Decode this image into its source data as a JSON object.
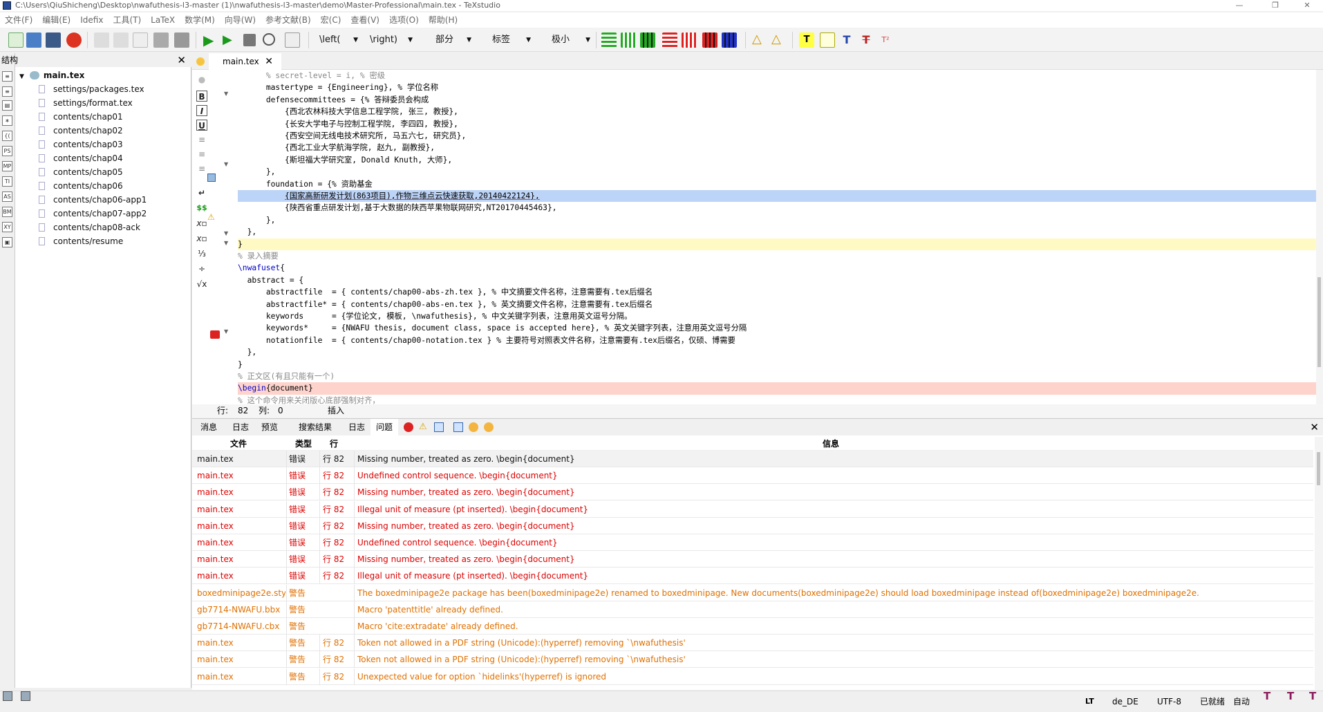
{
  "window": {
    "title": "C:\\Users\\QiuShicheng\\Desktop\\nwafuthesis-l3-master (1)\\nwafuthesis-l3-master\\demo\\Master-Professional\\main.tex - TeXstudio"
  },
  "menu": [
    "文件(F)",
    "编辑(E)",
    "Idefix",
    "工具(T)",
    "LaTeX",
    "数学(M)",
    "向导(W)",
    "参考文献(B)",
    "宏(C)",
    "查看(V)",
    "选项(O)",
    "帮助(H)"
  ],
  "toolbar": {
    "left_dd": "\\left(",
    "right_dd": "\\right)",
    "section_dd": "部分",
    "label_dd": "标签",
    "size_dd": "极小"
  },
  "structure": {
    "title": "结构",
    "root": "main.tex",
    "files": [
      "settings/packages.tex",
      "settings/format.tex",
      "contents/chap01",
      "contents/chap02",
      "contents/chap03",
      "contents/chap04",
      "contents/chap05",
      "contents/chap06",
      "contents/chap06-app1",
      "contents/chap07-app2",
      "contents/chap08-ack",
      "contents/resume"
    ]
  },
  "editor": {
    "tab": "main.tex",
    "lines": [
      {
        "pre": "      ",
        "kw": "",
        "text": "% secret-level = i, % 密级",
        "cls": "cmt"
      },
      {
        "pre": "      ",
        "kw": "",
        "text": "mastertype = {Engineering}, % 学位名称",
        "cls": ""
      },
      {
        "pre": "      ",
        "kw": "",
        "text": "defensecommittees = {% 答辩委员会构成",
        "cls": ""
      },
      {
        "pre": "          ",
        "kw": "",
        "text": "{西北农林科技大学信息工程学院, 张三, 教授},",
        "cls": ""
      },
      {
        "pre": "          ",
        "kw": "",
        "text": "{长安大学电子与控制工程学院, 李四四, 教授},",
        "cls": ""
      },
      {
        "pre": "          ",
        "kw": "",
        "text": "{西安空间无线电技术研究所, 马五六七, 研究员},",
        "cls": ""
      },
      {
        "pre": "          ",
        "kw": "",
        "text": "{西北工业大学航海学院, 赵九, 副教授},",
        "cls": ""
      },
      {
        "pre": "          ",
        "kw": "",
        "text": "{斯坦福大学研究室, Donald Knuth, 大师},",
        "cls": ""
      },
      {
        "pre": "      ",
        "kw": "",
        "text": "},",
        "cls": ""
      },
      {
        "pre": "      ",
        "kw": "",
        "text": "foundation = {% 资助基金",
        "cls": ""
      },
      {
        "pre": "          ",
        "kw": "",
        "text": "{国家高新研发计划(863项目),作物三维点云快速获取,20140422124},",
        "cls": "hl-sel"
      },
      {
        "pre": "          ",
        "kw": "",
        "text": "{陕西省重点研发计划,基于大数据的陕西苹果物联网研究,NT20170445463},",
        "cls": ""
      },
      {
        "pre": "      ",
        "kw": "",
        "text": "},",
        "cls": ""
      },
      {
        "pre": "  ",
        "kw": "",
        "text": "},",
        "cls": ""
      },
      {
        "pre": "",
        "kw": "",
        "text": "}",
        "cls": "hl-y"
      },
      {
        "pre": "",
        "kw": "",
        "text": "% 录入摘要",
        "cls": "cmt"
      },
      {
        "pre": "",
        "kw": "\\nwafuset",
        "text": "{",
        "cls": ""
      },
      {
        "pre": "  ",
        "kw": "",
        "text": "abstract = {",
        "cls": ""
      },
      {
        "pre": "      ",
        "kw": "",
        "text": "abstractfile  = { contents/chap00-abs-zh.tex }, % 中文摘要文件名称，注意需要有.tex后缀名",
        "cls": ""
      },
      {
        "pre": "      ",
        "kw": "",
        "text": "abstractfile* = { contents/chap00-abs-en.tex }, % 英文摘要文件名称，注意需要有.tex后缀名",
        "cls": ""
      },
      {
        "pre": "      ",
        "kw": "",
        "text": "keywords      = {学位论文, 模板, \\nwafuthesis}, % 中文关键字列表，注意用英文逗号分隔。",
        "cls": ""
      },
      {
        "pre": "      ",
        "kw": "",
        "text": "keywords*     = {NWAFU thesis, document class, space is accepted here}, % 英文关键字列表，注意用英文逗号分隔",
        "cls": ""
      },
      {
        "pre": "      ",
        "kw": "",
        "text": "notationfile  = { contents/chap00-notation.tex } % 主要符号对照表文件名称，注意需要有.tex后缀名，仅硕、博需要",
        "cls": ""
      },
      {
        "pre": "  ",
        "kw": "",
        "text": "},",
        "cls": ""
      },
      {
        "pre": "",
        "kw": "",
        "text": "}",
        "cls": ""
      },
      {
        "pre": "",
        "kw": "",
        "text": "% 正文区(有且只能有一个)",
        "cls": "cmt"
      },
      {
        "pre": "",
        "kw": "\\begin",
        "text": "{document}",
        "cls": "hl-r"
      },
      {
        "pre": "",
        "kw": "",
        "text": "% 这个命令用来关闭版心底部强制对齐，",
        "cls": "cmt"
      }
    ],
    "status": {
      "line_label": "行:",
      "line": "82",
      "col_label": "列:",
      "col": "0",
      "mode": "插入"
    }
  },
  "bottom": {
    "tabs": [
      "消息",
      "日志",
      "预览",
      "搜索结果",
      "日志",
      "问题"
    ],
    "headers": [
      "文件",
      "类型",
      "行",
      "信息"
    ],
    "rows": [
      {
        "file": "main.tex",
        "type": "错误",
        "line": "行 82",
        "msg": "Missing number, treated as zero. \\begin{document}",
        "cls": "sel"
      },
      {
        "file": "main.tex",
        "type": "错误",
        "line": "行 82",
        "msg": "Undefined control sequence. \\begin{document}",
        "cls": "err"
      },
      {
        "file": "main.tex",
        "type": "错误",
        "line": "行 82",
        "msg": "Missing number, treated as zero. \\begin{document}",
        "cls": "err"
      },
      {
        "file": "main.tex",
        "type": "错误",
        "line": "行 82",
        "msg": "Illegal unit of measure (pt inserted). \\begin{document}",
        "cls": "err"
      },
      {
        "file": "main.tex",
        "type": "错误",
        "line": "行 82",
        "msg": "Missing number, treated as zero. \\begin{document}",
        "cls": "err"
      },
      {
        "file": "main.tex",
        "type": "错误",
        "line": "行 82",
        "msg": "Undefined control sequence. \\begin{document}",
        "cls": "err"
      },
      {
        "file": "main.tex",
        "type": "错误",
        "line": "行 82",
        "msg": "Missing number, treated as zero. \\begin{document}",
        "cls": "err"
      },
      {
        "file": "main.tex",
        "type": "错误",
        "line": "行 82",
        "msg": "Illegal unit of measure (pt inserted). \\begin{document}",
        "cls": "err"
      },
      {
        "file": "boxedminipage2e.sty",
        "type": "警告",
        "line": "",
        "msg": "The boxedminipage2e package has been(boxedminipage2e) renamed to boxedminipage. New documents(boxedminipage2e) should load boxedminipage instead of(boxedminipage2e) boxedminipage2e.",
        "cls": "warn"
      },
      {
        "file": "gb7714-NWAFU.bbx",
        "type": "警告",
        "line": "",
        "msg": "Macro 'patenttitle' already defined.",
        "cls": "warn"
      },
      {
        "file": "gb7714-NWAFU.cbx",
        "type": "警告",
        "line": "",
        "msg": "Macro 'cite:extradate' already defined.",
        "cls": "warn"
      },
      {
        "file": "main.tex",
        "type": "警告",
        "line": "行 82",
        "msg": "Token not allowed in a PDF string (Unicode):(hyperref) removing `\\nwafuthesis'",
        "cls": "warn"
      },
      {
        "file": "main.tex",
        "type": "警告",
        "line": "行 82",
        "msg": "Token not allowed in a PDF string (Unicode):(hyperref) removing `\\nwafuthesis'",
        "cls": "warn"
      },
      {
        "file": "main.tex",
        "type": "警告",
        "line": "行 82",
        "msg": "Unexpected value for option `hidelinks'(hyperref) is ignored",
        "cls": "warn"
      }
    ]
  },
  "statusbar": {
    "lang": "de_DE",
    "encoding": "UTF-8",
    "ready": "已就绪",
    "auto": "自动"
  },
  "colors": {
    "error": "#dd0000",
    "warning": "#e07000",
    "selection": "#bcd4f7",
    "current_line": "#fff9c4",
    "error_line": "#fdd3cc"
  }
}
